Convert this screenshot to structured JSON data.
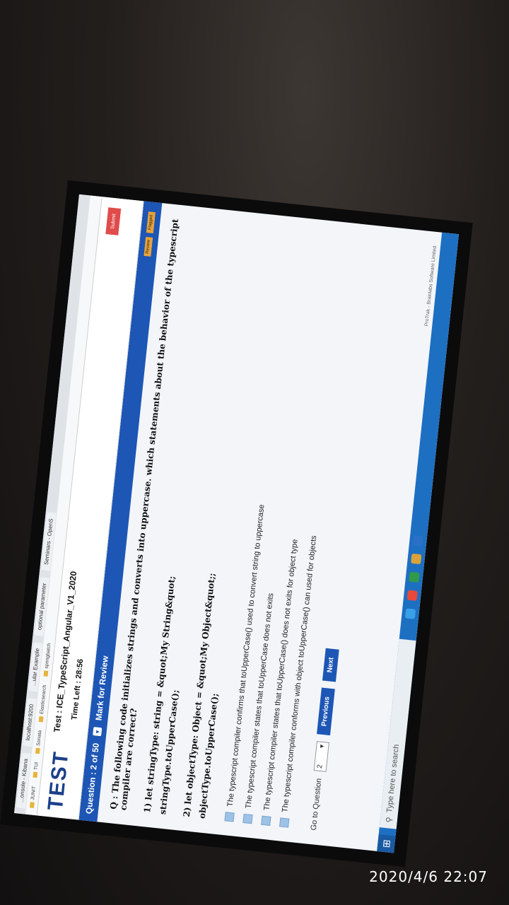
{
  "browser": {
    "tabs": [
      "...onsole - Kibana",
      "localhost:9200",
      "...ular Example",
      "optional parameter",
      "Seminars - OpenS"
    ],
    "bookmarks": [
      "JUNIT",
      "TUI",
      "Sonata",
      "Elasticsearch",
      "springbatch"
    ]
  },
  "header": {
    "logo": "TEST",
    "test_title": "Test : ICE_TypeScript_Angular_V1_2020",
    "time_left": "Time Left : 28:56",
    "submit_label": "Submit"
  },
  "question_bar": {
    "counter": "Question : 2 of 50",
    "mark_review": "Mark for Review",
    "legend": [
      "Review",
      "Flagged"
    ]
  },
  "question": {
    "prompt": "Q : The following code initializes strings and converts into uppercase. which statements about the behavior of the typescript compiler are correct?",
    "code1_line1": "1) let stringType: string = &quot;My String&quot;",
    "code1_line2": "stringType.toUpperCase();",
    "code2_line1": "2) let objectType: Object = &quot;My Object&quot;;",
    "code2_line2": "objectType.toUpperCase();",
    "options": [
      "The typescript compiler confirms that toUpperCase() used to convert string to uppercase",
      "The typescript compiler states that toUpperCase does not exits",
      "The typescript compiler states that toUpperCase() does not exits for object type",
      "The typescript compiler conforms with object toUpperCase() can used for objects"
    ]
  },
  "navigation": {
    "go_to_label": "Go to Question",
    "selected": "2",
    "previous": "Previous",
    "next": "Next"
  },
  "footer": {
    "copyright": "ProTrak - Brainlabs Software Limited"
  },
  "taskbar": {
    "search_placeholder": "Type here to search"
  },
  "photo_timestamp": "2020/4/6  22:07",
  "colors": {
    "accent": "#1d56b5",
    "taskbar": "#1d6fc2",
    "submit": "#e04b4b"
  }
}
